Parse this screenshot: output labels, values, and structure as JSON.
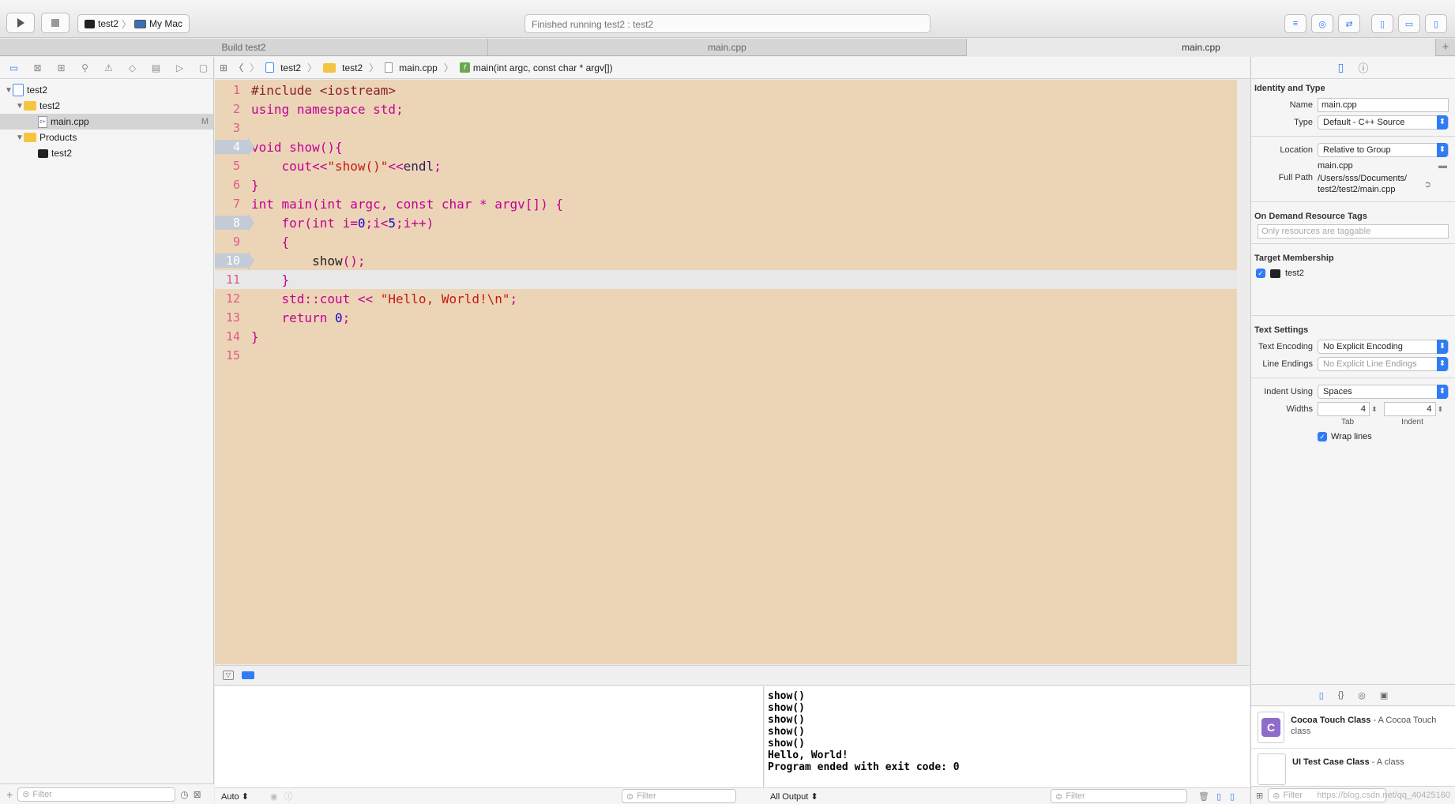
{
  "toolbar": {
    "scheme_target": "test2",
    "scheme_device": "My Mac",
    "activity_status": "Finished running test2 : test2"
  },
  "tabs": [
    {
      "label": "Build test2",
      "active": false
    },
    {
      "label": "main.cpp",
      "active": false
    },
    {
      "label": "main.cpp",
      "active": true
    }
  ],
  "navigator": {
    "tree": [
      {
        "label": "test2",
        "kind": "project",
        "depth": 0
      },
      {
        "label": "test2",
        "kind": "folder",
        "depth": 1
      },
      {
        "label": "main.cpp",
        "kind": "file",
        "depth": 2,
        "badge": "M",
        "selected": true
      },
      {
        "label": "Products",
        "kind": "folder",
        "depth": 1
      },
      {
        "label": "test2",
        "kind": "product",
        "depth": 2
      }
    ],
    "filter_placeholder": "Filter"
  },
  "jumpbar": {
    "crumbs": [
      "test2",
      "test2",
      "main.cpp",
      "main(int argc, const char * argv[])"
    ]
  },
  "editor": {
    "lines": [
      {
        "n": "1",
        "html": "<span class=\"pp\">#include &lt;iostream&gt;</span>"
      },
      {
        "n": "2",
        "html": "<span class=\"k\">using</span> <span class=\"k\">namespace</span> <span class=\"k\">std</span><span class=\"k\">;</span>"
      },
      {
        "n": "3",
        "html": ""
      },
      {
        "n": "4",
        "bp": true,
        "html": "<span class=\"k\">void</span> <span class=\"k\">show(){</span>"
      },
      {
        "n": "5",
        "html": "    <span class=\"k\">cout&lt;&lt;</span><span class=\"s\">\"show()\"</span><span class=\"k\">&lt;&lt;</span><span class=\"f\">endl</span><span class=\"k\">;</span>"
      },
      {
        "n": "6",
        "html": "<span class=\"k\">}</span>"
      },
      {
        "n": "7",
        "html": "<span class=\"k\">int</span> <span class=\"k\">main(int argc, const char * argv[]) {</span>"
      },
      {
        "n": "8",
        "bp": true,
        "html": "    <span class=\"k\">for(int i=</span><span class=\"n\">0</span><span class=\"k\">;i&lt;</span><span class=\"n\">5</span><span class=\"k\">;i++)</span>"
      },
      {
        "n": "9",
        "html": "    <span class=\"k\">{</span>"
      },
      {
        "n": "10",
        "bp": true,
        "html": "        <span class=\"t\">show</span><span class=\"k\">();</span>"
      },
      {
        "n": "11",
        "cur": true,
        "html": "    <span class=\"k\">}</span>"
      },
      {
        "n": "12",
        "html": "    <span class=\"k\">std::cout &lt;&lt;</span> <span class=\"s\">\"Hello, World!\\n\"</span><span class=\"k\">;</span>"
      },
      {
        "n": "13",
        "html": "    <span class=\"k\">return</span> <span class=\"n\">0</span><span class=\"k\">;</span>"
      },
      {
        "n": "14",
        "html": "<span class=\"k\">}</span>"
      },
      {
        "n": "15",
        "html": ""
      }
    ]
  },
  "console": {
    "lines": [
      "show()",
      "show()",
      "show()",
      "show()",
      "show()",
      "Hello, World!",
      "Program ended with exit code: 0"
    ]
  },
  "debug_footer": {
    "auto_label": "Auto ⬍",
    "left_filter": "Filter",
    "output_select": "All Output ⬍",
    "right_filter": "Filter"
  },
  "inspector": {
    "identity_title": "Identity and Type",
    "name_label": "Name",
    "name_value": "main.cpp",
    "type_label": "Type",
    "type_value": "Default - C++ Source",
    "location_label": "Location",
    "location_value": "Relative to Group",
    "location_file": "main.cpp",
    "fullpath_label": "Full Path",
    "fullpath_value": "/Users/sss/Documents/ test2/test2/main.cpp",
    "odr_title": "On Demand Resource Tags",
    "odr_placeholder": "Only resources are taggable",
    "target_title": "Target Membership",
    "target_item": "test2",
    "text_title": "Text Settings",
    "encoding_label": "Text Encoding",
    "encoding_value": "No Explicit Encoding",
    "endings_label": "Line Endings",
    "endings_value": "No Explicit Line Endings",
    "indent_label": "Indent Using",
    "indent_value": "Spaces",
    "widths_label": "Widths",
    "tab_width": "4",
    "indent_width": "4",
    "tab_caption": "Tab",
    "indent_caption": "Indent",
    "wrap_label": "Wrap lines",
    "library": [
      {
        "title": "Cocoa Touch Class",
        "desc": " - A Cocoa Touch class",
        "glyph": "C"
      },
      {
        "title": "UI Test Case Class",
        "desc": " - A class",
        "glyph": ""
      }
    ],
    "lib_filter": "Filter"
  },
  "watermark": "https://blog.csdn.net/qq_40425160"
}
